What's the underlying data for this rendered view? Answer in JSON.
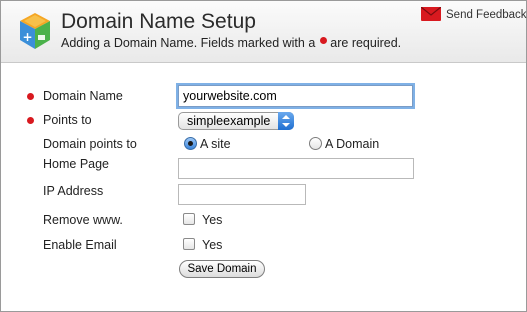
{
  "header": {
    "title": "Domain Name Setup",
    "subtitle_before": "Adding a Domain Name. Fields marked with a",
    "subtitle_after": "are required.",
    "feedback_label": "Send Feedback"
  },
  "form": {
    "domain_name": {
      "label": "Domain Name",
      "value": "yourwebsite.com",
      "required": true
    },
    "points_to": {
      "label": "Points to",
      "selected": "simpleexample",
      "required": true
    },
    "domain_points_to": {
      "label": "Domain points to",
      "options": [
        "A site",
        "A Domain"
      ],
      "selected": "A site"
    },
    "home_page": {
      "label": "Home Page",
      "value": ""
    },
    "ip_address": {
      "label": "IP Address",
      "value": ""
    },
    "remove_www": {
      "label": "Remove www.",
      "option": "Yes",
      "checked": false
    },
    "enable_email": {
      "label": "Enable Email",
      "option": "Yes",
      "checked": false
    },
    "submit_label": "Save Domain"
  },
  "colors": {
    "required_dot": "#d8191f",
    "focus_ring": "#7fb1e6",
    "select_accent": "#1f6fd1"
  }
}
